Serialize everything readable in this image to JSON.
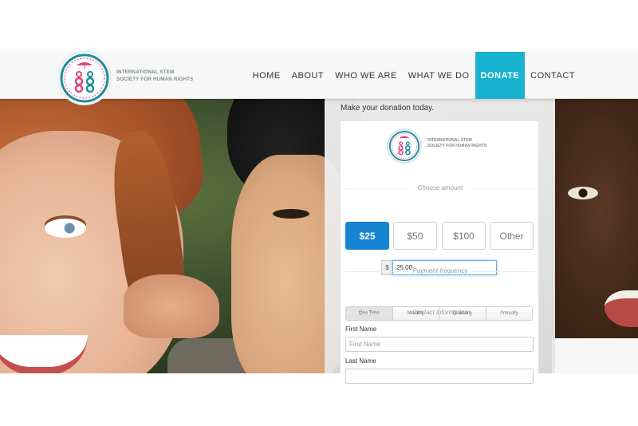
{
  "brand": {
    "name_line1": "INTERNATIONAL STEM",
    "name_line2": "SOCIETY FOR HUMAN RIGHTS"
  },
  "nav": {
    "items": [
      {
        "label": "HOME"
      },
      {
        "label": "ABOUT"
      },
      {
        "label": "WHO WE ARE"
      },
      {
        "label": "WHAT WE DO"
      },
      {
        "label": "DONATE",
        "active": true
      },
      {
        "label": "CONTACT"
      }
    ]
  },
  "donation": {
    "heading": "Make your donation today.",
    "choose_amount_label": "Choose amount",
    "amounts": [
      "$25",
      "$50",
      "$100",
      "Other"
    ],
    "selected_amount": "$25",
    "currency_symbol": "$",
    "amount_value": "25.00",
    "payment_frequency_label": "Payment frequency",
    "frequencies": [
      "One Time",
      "Monthly",
      "Quarterly",
      "Annually"
    ],
    "selected_frequency": "One Time",
    "contact_info_label": "Contact information",
    "first_name_label": "First Name",
    "first_name_placeholder": "First Name",
    "last_name_label": "Last Name"
  },
  "colors": {
    "accent": "#17b2cf",
    "selected_amount": "#1584d3",
    "logo_pink": "#e0457b",
    "logo_teal": "#1e8c9a"
  }
}
